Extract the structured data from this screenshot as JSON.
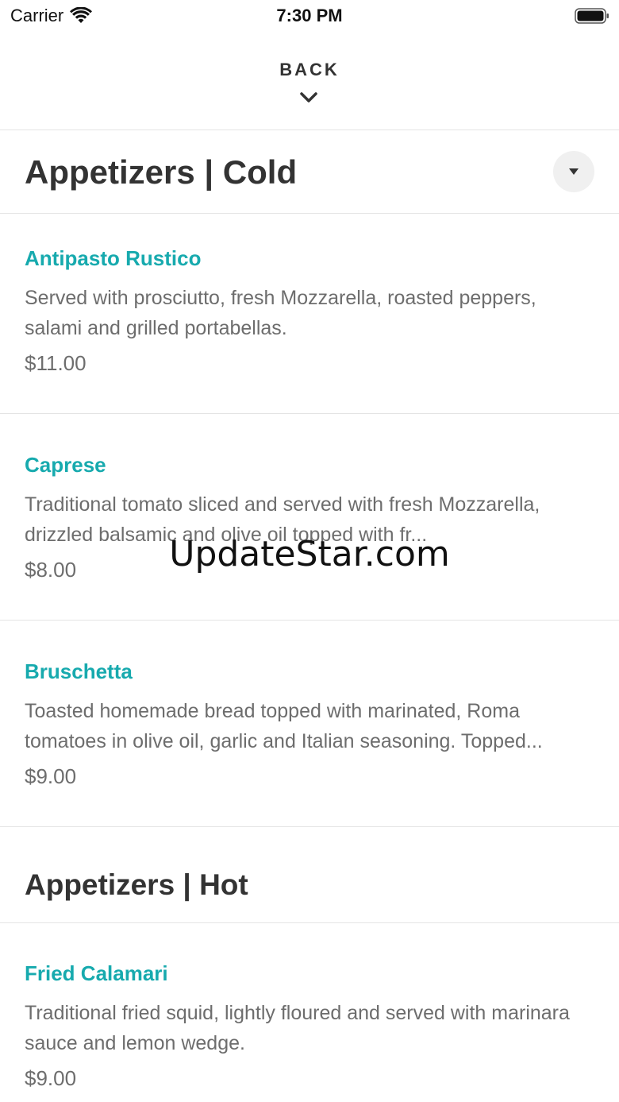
{
  "status_bar": {
    "carrier": "Carrier",
    "time": "7:30 PM"
  },
  "header": {
    "back_label": "BACK"
  },
  "sections": [
    {
      "title": "Appetizers | Cold",
      "items": [
        {
          "name": "Antipasto Rustico",
          "description": "Served with prosciutto, fresh Mozzarella, roasted peppers, salami and grilled portabellas.",
          "price": "$11.00"
        },
        {
          "name": "Caprese",
          "description": "Traditional tomato sliced and served with fresh Mozzarella, drizzled balsamic and olive oil topped with fr...",
          "price": "$8.00"
        },
        {
          "name": "Bruschetta",
          "description": "Toasted homemade bread topped with marinated, Roma tomatoes in olive oil, garlic and Italian seasoning. Topped...",
          "price": "$9.00"
        }
      ]
    },
    {
      "title": "Appetizers | Hot",
      "items": [
        {
          "name": "Fried Calamari",
          "description": "Traditional fried squid, lightly floured and served with marinara sauce and lemon wedge.",
          "price": "$9.00"
        }
      ]
    }
  ],
  "watermark": "UpdateStar.com",
  "colors": {
    "item_name": "#17aaae",
    "text": "#333333",
    "muted": "#6d6d6d",
    "divider": "#e4e4e4"
  }
}
